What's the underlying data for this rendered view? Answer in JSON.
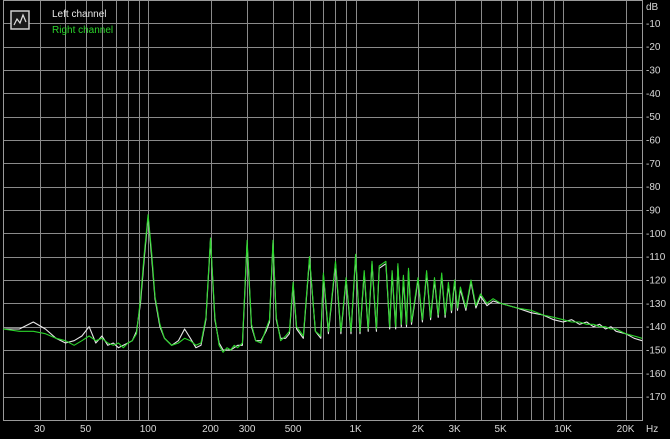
{
  "chart_data": {
    "type": "line",
    "title": "",
    "xlabel": "",
    "ylabel": "",
    "x_unit": "Hz",
    "y_unit": "dB",
    "x_scale": "log",
    "xlim": [
      20,
      24000
    ],
    "ylim": [
      -180,
      0
    ],
    "grid": true,
    "legend_position": "top-left",
    "x_ticks": [
      {
        "value": 30,
        "label": "30"
      },
      {
        "value": 50,
        "label": "50"
      },
      {
        "value": 100,
        "label": "100"
      },
      {
        "value": 200,
        "label": "200"
      },
      {
        "value": 300,
        "label": "300"
      },
      {
        "value": 500,
        "label": "500"
      },
      {
        "value": 1000,
        "label": "1K"
      },
      {
        "value": 2000,
        "label": "2K"
      },
      {
        "value": 3000,
        "label": "3K"
      },
      {
        "value": 5000,
        "label": "5K"
      },
      {
        "value": 10000,
        "label": "10K"
      },
      {
        "value": 20000,
        "label": "20K"
      }
    ],
    "y_ticks": [
      {
        "value": -10,
        "label": "-10"
      },
      {
        "value": -20,
        "label": "-20"
      },
      {
        "value": -30,
        "label": "-30"
      },
      {
        "value": -40,
        "label": "-40"
      },
      {
        "value": -50,
        "label": "-50"
      },
      {
        "value": -60,
        "label": "-60"
      },
      {
        "value": -70,
        "label": "-70"
      },
      {
        "value": -80,
        "label": "-80"
      },
      {
        "value": -90,
        "label": "-90"
      },
      {
        "value": -100,
        "label": "-100"
      },
      {
        "value": -110,
        "label": "-110"
      },
      {
        "value": -120,
        "label": "-120"
      },
      {
        "value": -130,
        "label": "-130"
      },
      {
        "value": -140,
        "label": "-140"
      },
      {
        "value": -150,
        "label": "-150"
      },
      {
        "value": -160,
        "label": "-160"
      },
      {
        "value": -170,
        "label": "-170"
      }
    ],
    "series": [
      {
        "name": "Left channel",
        "color": "#e8e8e8",
        "points": [
          [
            20,
            -141
          ],
          [
            24,
            -141
          ],
          [
            28,
            -138
          ],
          [
            32,
            -141
          ],
          [
            36,
            -145
          ],
          [
            40,
            -147
          ],
          [
            44,
            -146
          ],
          [
            48,
            -144
          ],
          [
            52,
            -140
          ],
          [
            56,
            -147
          ],
          [
            60,
            -144
          ],
          [
            64,
            -148
          ],
          [
            68,
            -147
          ],
          [
            72,
            -149
          ],
          [
            76,
            -148
          ],
          [
            80,
            -147
          ],
          [
            84,
            -146
          ],
          [
            88,
            -142
          ],
          [
            92,
            -130
          ],
          [
            96,
            -110
          ],
          [
            100,
            -93
          ],
          [
            104,
            -110
          ],
          [
            108,
            -128
          ],
          [
            114,
            -140
          ],
          [
            120,
            -145
          ],
          [
            130,
            -148
          ],
          [
            140,
            -146
          ],
          [
            150,
            -141
          ],
          [
            160,
            -145
          ],
          [
            170,
            -149
          ],
          [
            180,
            -148
          ],
          [
            190,
            -137
          ],
          [
            200,
            -103
          ],
          [
            210,
            -137
          ],
          [
            220,
            -147
          ],
          [
            230,
            -150
          ],
          [
            240,
            -150
          ],
          [
            250,
            -150
          ],
          [
            260,
            -149
          ],
          [
            270,
            -148
          ],
          [
            285,
            -148
          ],
          [
            300,
            -104
          ],
          [
            315,
            -140
          ],
          [
            330,
            -146
          ],
          [
            350,
            -146
          ],
          [
            370,
            -142
          ],
          [
            385,
            -138
          ],
          [
            400,
            -104
          ],
          [
            415,
            -137
          ],
          [
            435,
            -145
          ],
          [
            460,
            -145
          ],
          [
            480,
            -143
          ],
          [
            500,
            -122
          ],
          [
            520,
            -141
          ],
          [
            560,
            -145
          ],
          [
            600,
            -111
          ],
          [
            640,
            -142
          ],
          [
            680,
            -145
          ],
          [
            700,
            -118
          ],
          [
            740,
            -143
          ],
          [
            800,
            -113
          ],
          [
            850,
            -143
          ],
          [
            900,
            -120
          ],
          [
            950,
            -143
          ],
          [
            1000,
            -110
          ],
          [
            1050,
            -143
          ],
          [
            1100,
            -117
          ],
          [
            1150,
            -142
          ],
          [
            1200,
            -113
          ],
          [
            1260,
            -142
          ],
          [
            1300,
            -115
          ],
          [
            1400,
            -113
          ],
          [
            1460,
            -141
          ],
          [
            1500,
            -117
          ],
          [
            1560,
            -141
          ],
          [
            1600,
            -114
          ],
          [
            1660,
            -140
          ],
          [
            1700,
            -119
          ],
          [
            1760,
            -140
          ],
          [
            1800,
            -116
          ],
          [
            1860,
            -139
          ],
          [
            2000,
            -120
          ],
          [
            2100,
            -138
          ],
          [
            2200,
            -117
          ],
          [
            2300,
            -137
          ],
          [
            2400,
            -120
          ],
          [
            2500,
            -136
          ],
          [
            2600,
            -118
          ],
          [
            2700,
            -136
          ],
          [
            2800,
            -122
          ],
          [
            2900,
            -134
          ],
          [
            3000,
            -121
          ],
          [
            3100,
            -133
          ],
          [
            3200,
            -124
          ],
          [
            3400,
            -133
          ],
          [
            3600,
            -121
          ],
          [
            3800,
            -132
          ],
          [
            4000,
            -127
          ],
          [
            4300,
            -131
          ],
          [
            4600,
            -129
          ],
          [
            5000,
            -130
          ],
          [
            6000,
            -132
          ],
          [
            7000,
            -134
          ],
          [
            8000,
            -135
          ],
          [
            9000,
            -137
          ],
          [
            10000,
            -138
          ],
          [
            11000,
            -137
          ],
          [
            12000,
            -139
          ],
          [
            13000,
            -138
          ],
          [
            14000,
            -140
          ],
          [
            15000,
            -139
          ],
          [
            16000,
            -141
          ],
          [
            17000,
            -140
          ],
          [
            18000,
            -142
          ],
          [
            20000,
            -143
          ],
          [
            22000,
            -145
          ],
          [
            24000,
            -146
          ]
        ]
      },
      {
        "name": "Right channel",
        "color": "#2bd42b",
        "points": [
          [
            20,
            -141
          ],
          [
            24,
            -142
          ],
          [
            28,
            -142
          ],
          [
            32,
            -143
          ],
          [
            36,
            -145
          ],
          [
            40,
            -146
          ],
          [
            44,
            -148
          ],
          [
            48,
            -146
          ],
          [
            52,
            -144
          ],
          [
            56,
            -146
          ],
          [
            60,
            -145
          ],
          [
            64,
            -147
          ],
          [
            68,
            -148
          ],
          [
            72,
            -147
          ],
          [
            76,
            -149
          ],
          [
            80,
            -147
          ],
          [
            84,
            -146
          ],
          [
            88,
            -143
          ],
          [
            92,
            -128
          ],
          [
            96,
            -108
          ],
          [
            100,
            -92
          ],
          [
            104,
            -108
          ],
          [
            108,
            -127
          ],
          [
            114,
            -139
          ],
          [
            120,
            -145
          ],
          [
            130,
            -148
          ],
          [
            140,
            -147
          ],
          [
            150,
            -145
          ],
          [
            160,
            -146
          ],
          [
            170,
            -148
          ],
          [
            180,
            -147
          ],
          [
            190,
            -136
          ],
          [
            200,
            -102
          ],
          [
            210,
            -136
          ],
          [
            220,
            -148
          ],
          [
            230,
            -151
          ],
          [
            240,
            -149
          ],
          [
            250,
            -150
          ],
          [
            260,
            -148
          ],
          [
            270,
            -149
          ],
          [
            285,
            -147
          ],
          [
            300,
            -103
          ],
          [
            315,
            -139
          ],
          [
            330,
            -146
          ],
          [
            350,
            -147
          ],
          [
            370,
            -141
          ],
          [
            385,
            -137
          ],
          [
            400,
            -103
          ],
          [
            415,
            -136
          ],
          [
            435,
            -146
          ],
          [
            460,
            -144
          ],
          [
            480,
            -142
          ],
          [
            500,
            -121
          ],
          [
            520,
            -140
          ],
          [
            560,
            -144
          ],
          [
            600,
            -110
          ],
          [
            640,
            -142
          ],
          [
            680,
            -144
          ],
          [
            700,
            -117
          ],
          [
            740,
            -142
          ],
          [
            800,
            -112
          ],
          [
            850,
            -142
          ],
          [
            900,
            -119
          ],
          [
            950,
            -142
          ],
          [
            1000,
            -109
          ],
          [
            1050,
            -142
          ],
          [
            1100,
            -116
          ],
          [
            1150,
            -141
          ],
          [
            1200,
            -112
          ],
          [
            1260,
            -141
          ],
          [
            1300,
            -114
          ],
          [
            1400,
            -112
          ],
          [
            1460,
            -140
          ],
          [
            1500,
            -116
          ],
          [
            1560,
            -140
          ],
          [
            1600,
            -113
          ],
          [
            1660,
            -139
          ],
          [
            1700,
            -118
          ],
          [
            1760,
            -139
          ],
          [
            1800,
            -115
          ],
          [
            1860,
            -138
          ],
          [
            2000,
            -119
          ],
          [
            2100,
            -137
          ],
          [
            2200,
            -116
          ],
          [
            2300,
            -136
          ],
          [
            2400,
            -119
          ],
          [
            2500,
            -135
          ],
          [
            2600,
            -117
          ],
          [
            2700,
            -135
          ],
          [
            2800,
            -121
          ],
          [
            2900,
            -133
          ],
          [
            3000,
            -120
          ],
          [
            3100,
            -132
          ],
          [
            3200,
            -123
          ],
          [
            3400,
            -132
          ],
          [
            3600,
            -120
          ],
          [
            3800,
            -131
          ],
          [
            4000,
            -126
          ],
          [
            4300,
            -130
          ],
          [
            4600,
            -128
          ],
          [
            5000,
            -130
          ],
          [
            6000,
            -132
          ],
          [
            7000,
            -133
          ],
          [
            8000,
            -135
          ],
          [
            9000,
            -136
          ],
          [
            10000,
            -137
          ],
          [
            11000,
            -138
          ],
          [
            12000,
            -138
          ],
          [
            13000,
            -139
          ],
          [
            14000,
            -139
          ],
          [
            15000,
            -140
          ],
          [
            16000,
            -140
          ],
          [
            17000,
            -141
          ],
          [
            18000,
            -141
          ],
          [
            20000,
            -143
          ],
          [
            22000,
            -144
          ],
          [
            24000,
            -145
          ]
        ]
      }
    ]
  }
}
